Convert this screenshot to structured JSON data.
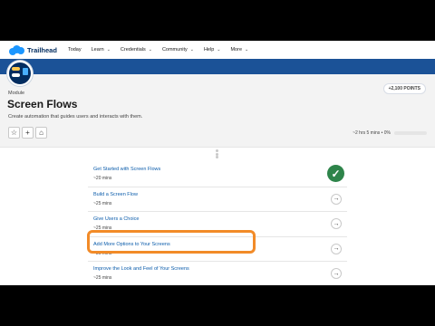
{
  "nav": {
    "brand": "Trailhead",
    "items": [
      {
        "label": "Today",
        "dropdown": false
      },
      {
        "label": "Learn",
        "dropdown": true
      },
      {
        "label": "Credentials",
        "dropdown": true
      },
      {
        "label": "Community",
        "dropdown": true
      },
      {
        "label": "Help",
        "dropdown": true
      },
      {
        "label": "More",
        "dropdown": true
      }
    ],
    "caret": "⌄"
  },
  "module": {
    "label": "Module",
    "title": "Screen Flows",
    "description": "Create automation that guides users and interacts with them.",
    "points": "+2,100 POINTS",
    "progress_text": "~2 hrs 5 mins  •  0%",
    "progress_value": 0,
    "actions": [
      {
        "name": "favorite-star-icon",
        "glyph": "☆"
      },
      {
        "name": "add-to-trailmix-icon",
        "glyph": "+"
      },
      {
        "name": "tag-icon",
        "glyph": "⌂"
      }
    ]
  },
  "units": [
    {
      "title": "Get Started with Screen Flows",
      "time": "~20 mins",
      "completed": true
    },
    {
      "title": "Build a Screen Flow",
      "time": "~25 mins",
      "completed": false
    },
    {
      "title": "Give Users a Choice",
      "time": "~25 mins",
      "completed": false
    },
    {
      "title": "Add More Options to Your Screens",
      "time": "~30 mins",
      "completed": false
    },
    {
      "title": "Improve the Look and Feel of Your Screens",
      "time": "~25 mins",
      "completed": false
    }
  ],
  "icons": {
    "arrow": "→",
    "check": "✓"
  },
  "colors": {
    "accent": "#0b5cab",
    "banner": "#1b5297",
    "complete": "#2e844a",
    "highlight": "#f28b28"
  }
}
